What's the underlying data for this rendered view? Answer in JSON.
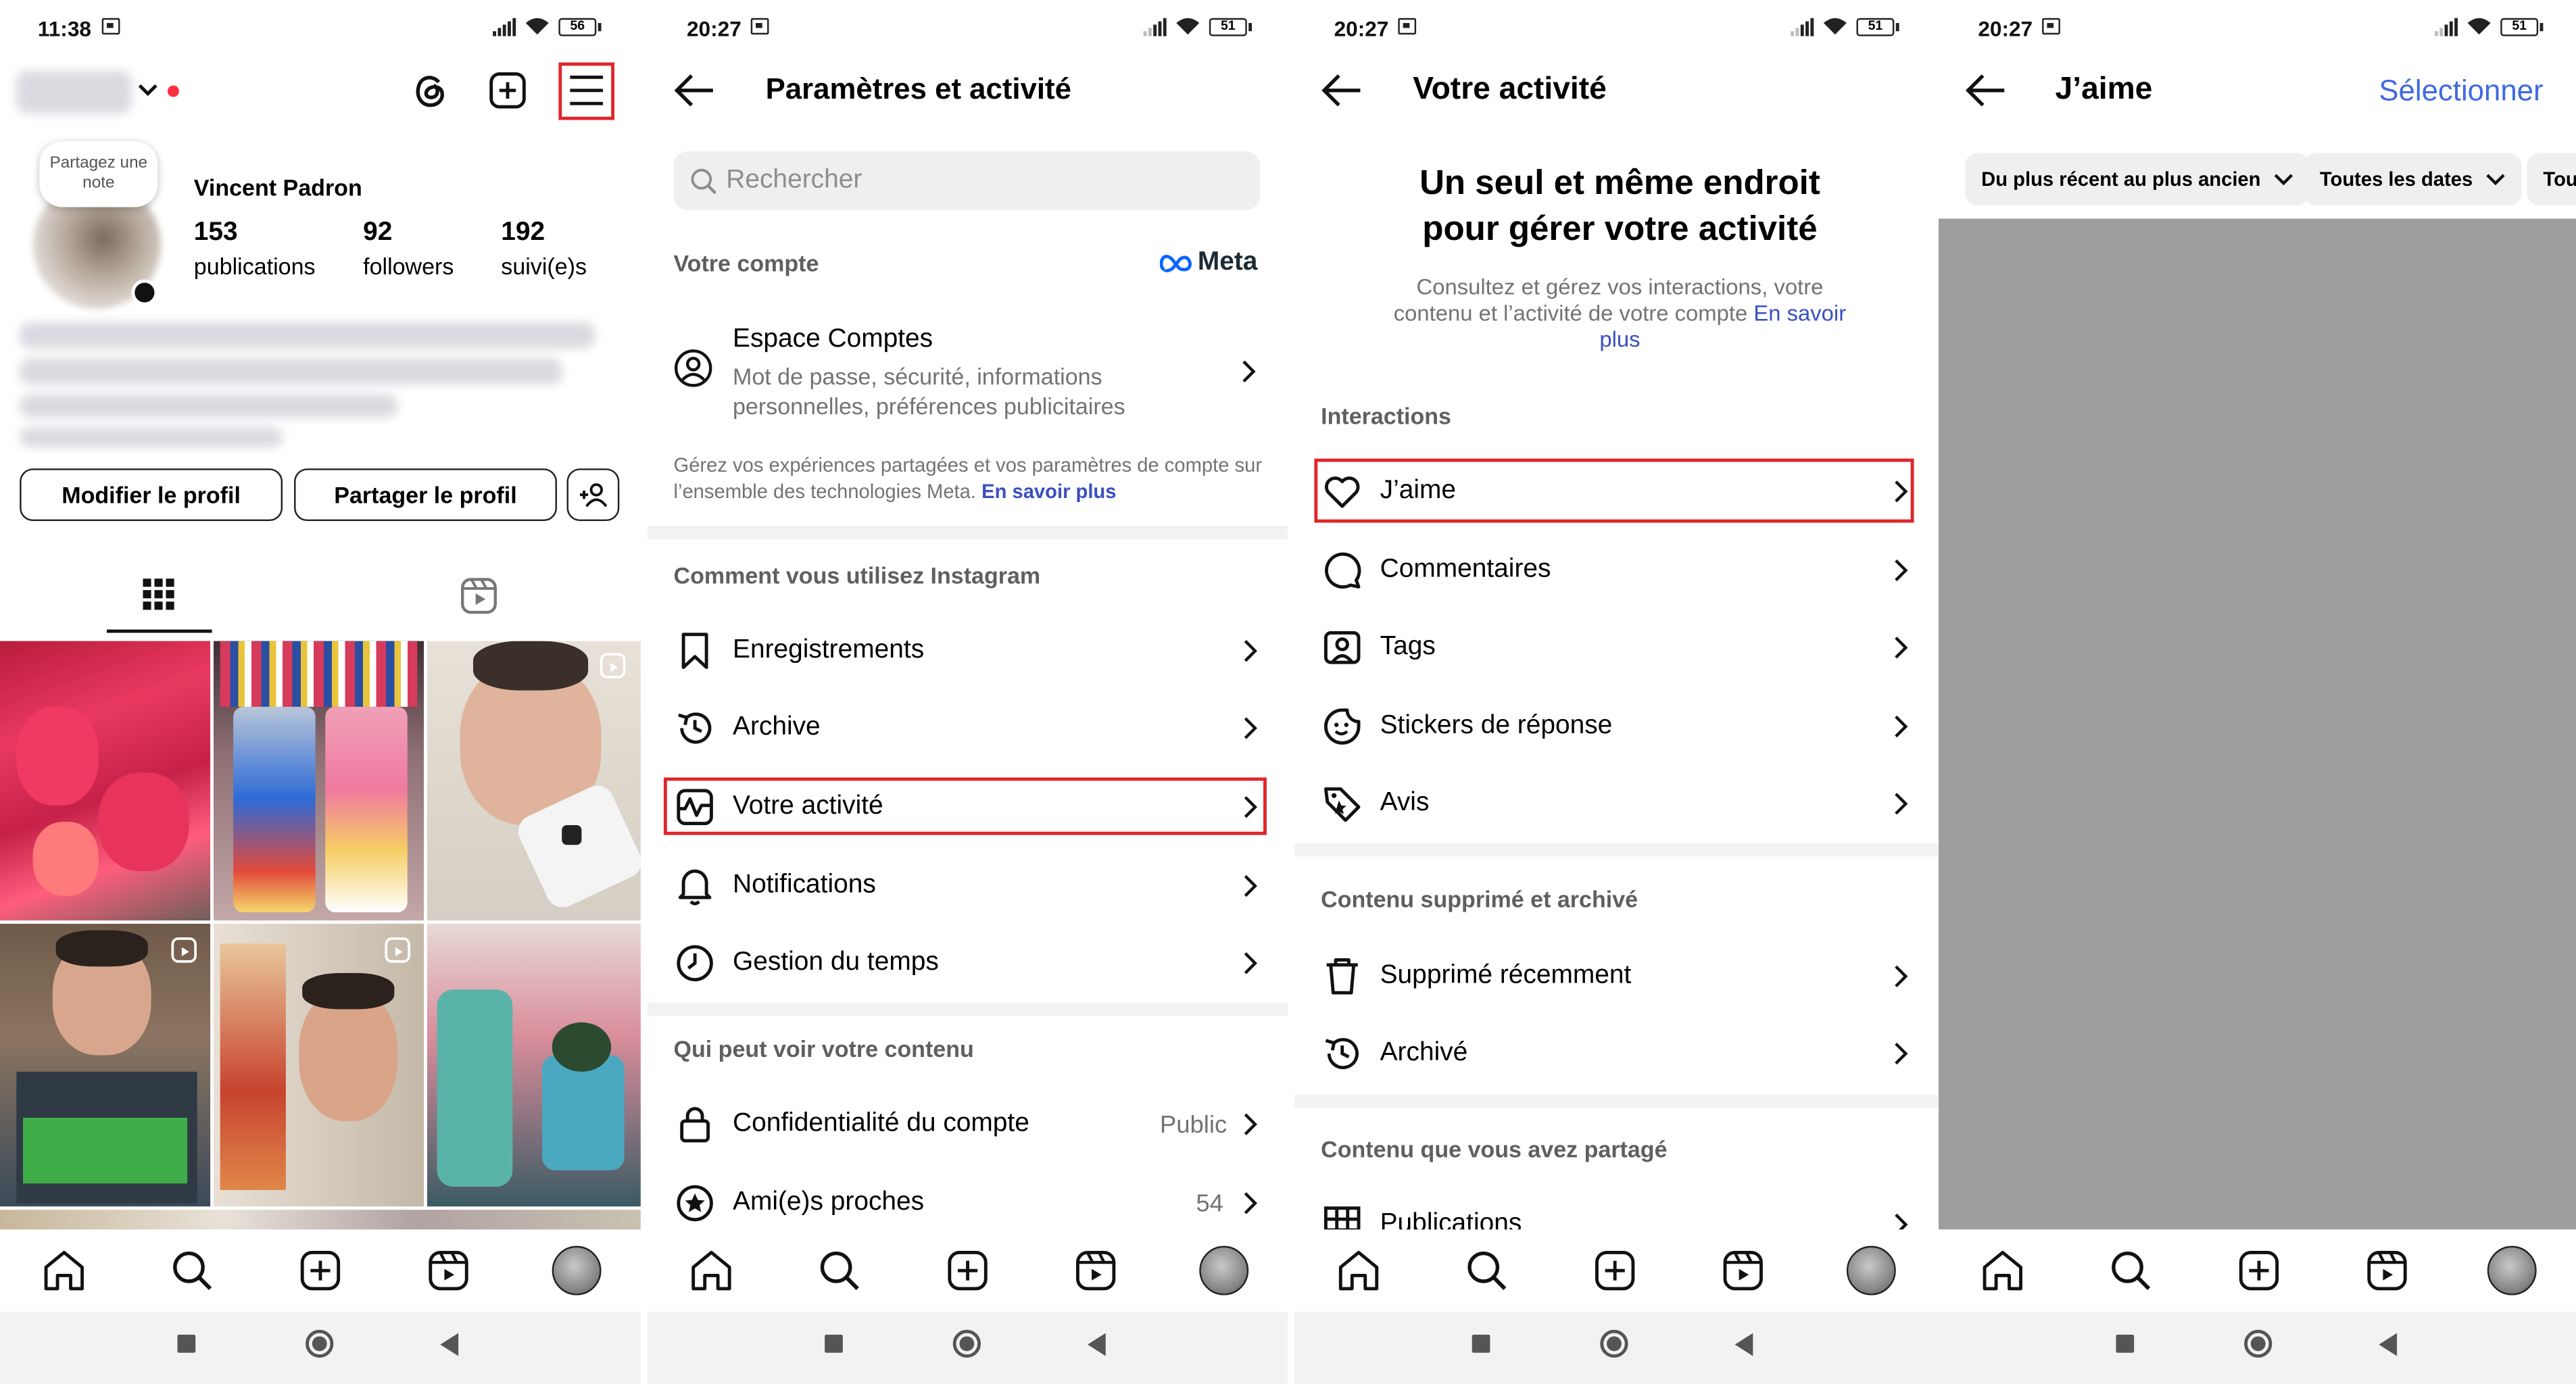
{
  "screens": [
    {
      "status": {
        "time": "11:38",
        "battery": "56"
      },
      "profile": {
        "note_bubble": "Partagez une note",
        "name": "Vincent Padron",
        "stats": [
          {
            "value": "153",
            "label": "publications"
          },
          {
            "value": "92",
            "label": "followers"
          },
          {
            "value": "192",
            "label": "suivi(e)s"
          }
        ],
        "edit_button": "Modifier le profil",
        "share_button": "Partager le profil"
      }
    },
    {
      "status": {
        "time": "20:27",
        "battery": "51"
      },
      "title": "Paramètres et activité",
      "search_placeholder": "Rechercher",
      "account_section": "Votre compte",
      "meta_logo": "Meta",
      "accounts_center": {
        "title": "Espace Comptes",
        "subtitle": "Mot de passe, sécurité, informations personnelles, préférences publicitaires"
      },
      "accounts_note": "Gérez vos expériences partagées et vos paramètres de compte sur l’ensemble des technologies Meta.",
      "accounts_note_link": "En savoir plus",
      "usage_section": "Comment vous utilisez Instagram",
      "usage_items": [
        "Enregistrements",
        "Archive",
        "Votre activité",
        "Notifications",
        "Gestion du temps"
      ],
      "visibility_section": "Qui peut voir votre contenu",
      "privacy_item": {
        "label": "Confidentialité du compte",
        "value": "Public"
      },
      "close_friends_item": {
        "label": "Ami(e)s proches",
        "value": "54"
      }
    },
    {
      "status": {
        "time": "20:27",
        "battery": "51"
      },
      "title": "Votre activité",
      "hero_title": "Un seul et même endroit pour gérer votre activité",
      "hero_desc": "Consultez et gérez vos interactions, votre contenu et l’activité de votre compte",
      "hero_link": "En savoir plus",
      "interactions_section": "Interactions",
      "interactions": [
        "J’aime",
        "Commentaires",
        "Tags",
        "Stickers de réponse",
        "Avis"
      ],
      "deleted_section": "Contenu supprimé et archivé",
      "deleted_items": [
        "Supprimé récemment",
        "Archivé"
      ],
      "shared_section": "Contenu que vous avez partagé",
      "shared_items": [
        "Publications"
      ]
    },
    {
      "status": {
        "time": "20:27",
        "battery": "51"
      },
      "title": "J’aime",
      "select_label": "Sélectionner",
      "filters": [
        "Du plus récent au plus ancien",
        "Toutes les dates",
        "Tou"
      ]
    }
  ],
  "colors": {
    "highlight": "#e0262b",
    "link": "#3a4fc1",
    "select_blue": "#3f6ae0",
    "placeholder_grey": "#9e9e9e"
  }
}
